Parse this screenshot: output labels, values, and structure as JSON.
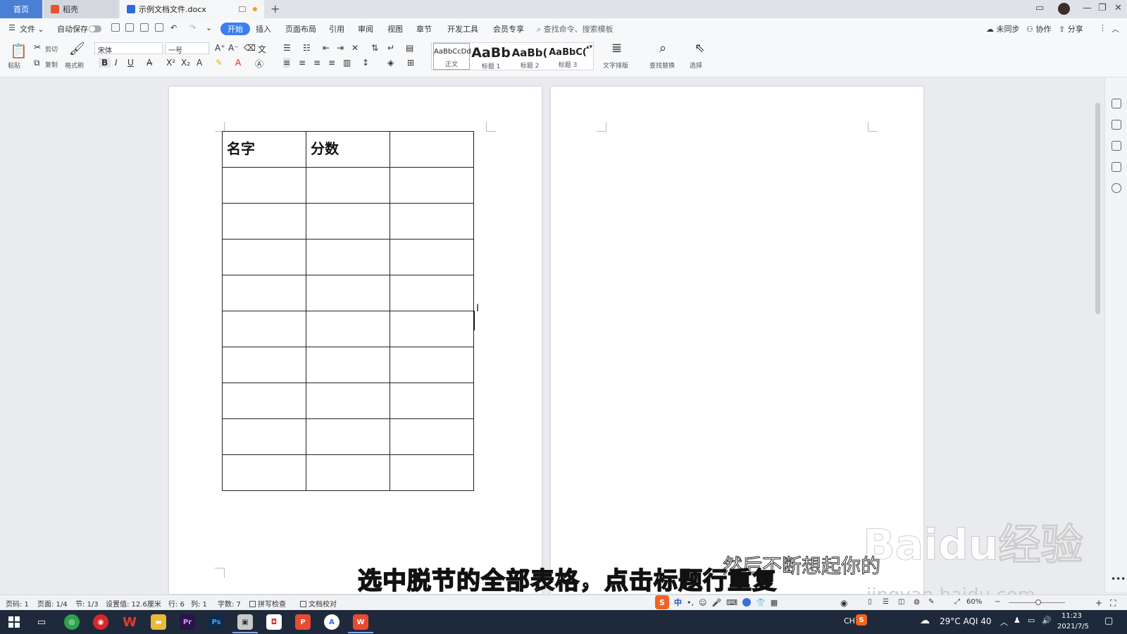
{
  "tabs": {
    "home": "首页",
    "daoke": "稻壳",
    "document": "示例文档文件.docx",
    "add": "+"
  },
  "window_controls": {
    "minimize": "—",
    "restore": "❐",
    "close": "✕"
  },
  "menu": {
    "file": "文件",
    "autosave": "自动保存",
    "items": [
      "开始",
      "插入",
      "页面布局",
      "引用",
      "审阅",
      "视图",
      "章节",
      "开发工具",
      "会员专享"
    ],
    "search": "查找命令、搜索模板",
    "unsynced": "未同步",
    "collab": "协作",
    "share": "分享"
  },
  "ribbon": {
    "paste": "粘贴",
    "cut": "剪切",
    "copy": "复制",
    "format_painter": "格式刷",
    "font_name": "宋体",
    "font_size": "一号",
    "bold": "B",
    "italic": "I",
    "underline": "U",
    "styles": [
      {
        "sample": "AaBbCcDd",
        "name": "正文"
      },
      {
        "sample": "AaBb",
        "name": "标题 1"
      },
      {
        "sample": "AaBb(",
        "name": "标题 2"
      },
      {
        "sample": "AaBbC(",
        "name": "标题 3"
      }
    ],
    "text_layout": "文字排版",
    "find_replace": "查找替换",
    "select": "选择"
  },
  "table": {
    "header": [
      "名字",
      "分数",
      ""
    ],
    "empty_rows": 9
  },
  "subtitle": {
    "main": "选中脱节的全部表格，点击标题行重复",
    "lyric": "然后不断想起你的"
  },
  "watermark": {
    "brand": "Baidu经验",
    "url": "jingyan.baidu.com"
  },
  "status": {
    "page_num": "页码: 1",
    "pages": "页面: 1/4",
    "section": "节: 1/3",
    "setting": "设置值: 12.6厘米",
    "row": "行: 6",
    "col": "列: 1",
    "words": "字数: 7",
    "spell_check": "拼写检查",
    "doc_proof": "文档校对",
    "zoom": "60%"
  },
  "taskbar": {
    "weather": "29°C AQI 40",
    "ime_lang": "CH",
    "time": "11:23",
    "date": "2021/7/5"
  },
  "colors": {
    "accent": "#3d7ff0",
    "home_tab": "#4a7fd6",
    "taskbar": "#1e2a3c"
  }
}
